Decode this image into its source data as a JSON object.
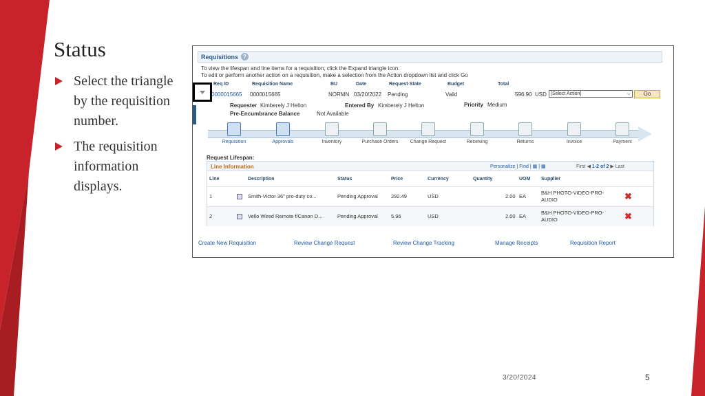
{
  "slide": {
    "title": "Status",
    "bullets": [
      "Select the triangle by the requisition number.",
      "The requisition information displays."
    ],
    "date": "3/20/2024",
    "page_number": "5"
  },
  "app": {
    "section_title": "Requisitions",
    "help_glyph": "?",
    "instructions": [
      "To view the lifespan and line items for a requisition, click the Expand triangle icon.",
      "To edit or perform another action on a requisition, make a selection from the Action dropdown list and click Go"
    ],
    "columns": [
      "Req ID",
      "Requisition Name",
      "BU",
      "Date",
      "Request State",
      "Budget",
      "Total"
    ],
    "requisition": {
      "req_id": "0000015665",
      "name": "0000015665",
      "bu": "NORMN",
      "date": "03/20/2022",
      "state": "Pending",
      "budget": "Valid",
      "total": "596.90",
      "currency": "USD",
      "action_selected": "[Select Action]",
      "go_label": "Go"
    },
    "details": {
      "requester_label": "Requester",
      "requester": "Kimberely J Helton",
      "entered_by_label": "Entered By",
      "entered_by": "Kimberely J Helton",
      "priority_label": "Priority",
      "priority": "Medium",
      "encumbrance_label": "Pre-Encumbrance Balance",
      "encumbrance": "Not Available"
    },
    "lifespan_steps": [
      {
        "label": "Requisition",
        "icon": "requisition-icon",
        "active": true
      },
      {
        "label": "Approvals",
        "icon": "approvals-icon",
        "active": true
      },
      {
        "label": "Inventory",
        "icon": "inventory-icon",
        "active": false
      },
      {
        "label": "Purchase Orders",
        "icon": "purchase-orders-icon",
        "active": false
      },
      {
        "label": "Change Request",
        "icon": "change-request-icon",
        "active": false
      },
      {
        "label": "Receiving",
        "icon": "receiving-icon",
        "active": false
      },
      {
        "label": "Returns",
        "icon": "returns-icon",
        "active": false
      },
      {
        "label": "Invoice",
        "icon": "invoice-icon",
        "active": false
      },
      {
        "label": "Payment",
        "icon": "payment-icon",
        "active": false
      }
    ],
    "request_lifespan_label": "Request Lifespan:",
    "line_info": {
      "title": "Line Information",
      "personalize": "Personalize",
      "find": "Find",
      "pager_first": "First",
      "pager_range": "1-2 of 2",
      "pager_last": "Last",
      "headers": [
        "Line",
        "Description",
        "Status",
        "Price",
        "Currency",
        "Quantity",
        "UOM",
        "Supplier"
      ],
      "rows": [
        {
          "line": "1",
          "description": "Smith-Victor 36\" pro-duty co...",
          "status": "Pending Approval",
          "price": "292.49",
          "currency": "USD",
          "quantity": "2.00",
          "uom": "EA",
          "supplier": "B&H PHOTO-VIDEO-PRO-AUDIO"
        },
        {
          "line": "2",
          "description": "Vello Wired Remote f/Canon D...",
          "status": "Pending Approval",
          "price": "5.96",
          "currency": "USD",
          "quantity": "2.00",
          "uom": "EA",
          "supplier": "B&H PHOTO-VIDEO-PRO-AUDIO"
        }
      ]
    },
    "bottom_links": [
      "Create New Requisition",
      "Review Change Request",
      "Review Change Tracking",
      "Manage Receipts",
      "Requisition Report"
    ]
  },
  "colors": {
    "accent_red": "#c8232a",
    "link_blue": "#1f5aa6",
    "header_orange": "#c06a1a"
  }
}
